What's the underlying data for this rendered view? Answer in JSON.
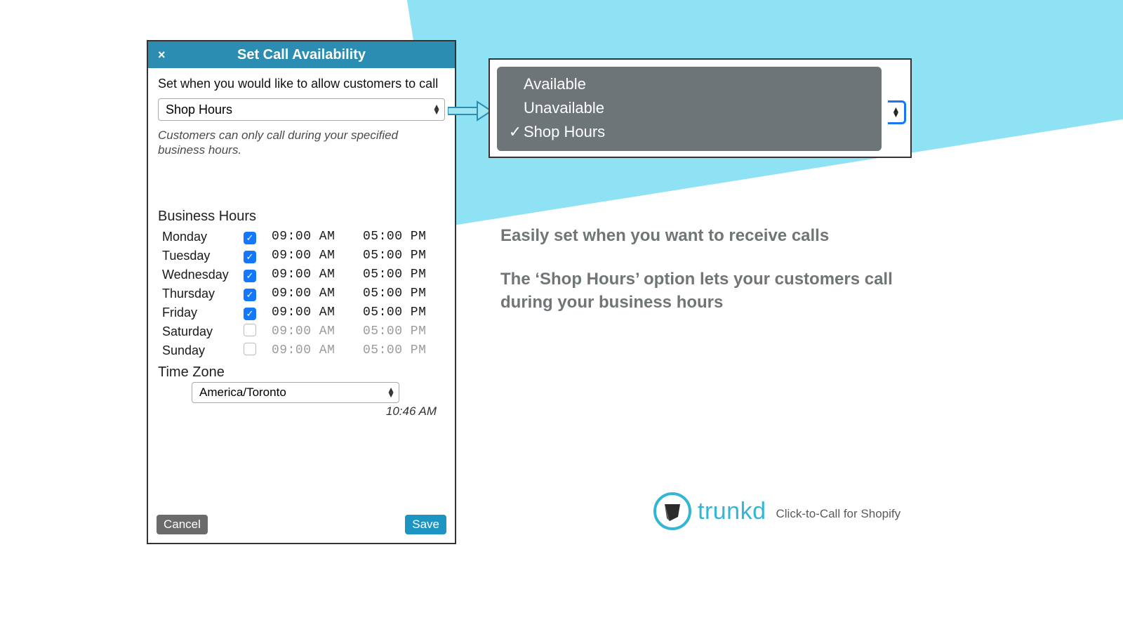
{
  "dialog": {
    "title": "Set Call Availability",
    "prompt": "Set when you would like to allow customers to call",
    "mode_select": {
      "value": "Shop Hours"
    },
    "help_text": "Customers can only call during your specified business hours.",
    "business_hours_heading": "Business Hours",
    "days": [
      {
        "name": "Monday",
        "enabled": true,
        "open": "09:00 AM",
        "close": "05:00 PM"
      },
      {
        "name": "Tuesday",
        "enabled": true,
        "open": "09:00 AM",
        "close": "05:00 PM"
      },
      {
        "name": "Wednesday",
        "enabled": true,
        "open": "09:00 AM",
        "close": "05:00 PM"
      },
      {
        "name": "Thursday",
        "enabled": true,
        "open": "09:00 AM",
        "close": "05:00 PM"
      },
      {
        "name": "Friday",
        "enabled": true,
        "open": "09:00 AM",
        "close": "05:00 PM"
      },
      {
        "name": "Saturday",
        "enabled": false,
        "open": "09:00 AM",
        "close": "05:00 PM"
      },
      {
        "name": "Sunday",
        "enabled": false,
        "open": "09:00 AM",
        "close": "05:00 PM"
      }
    ],
    "timezone_heading": "Time Zone",
    "timezone_value": "America/Toronto",
    "timezone_local_time": "10:46 AM",
    "cancel_label": "Cancel",
    "save_label": "Save"
  },
  "options_menu": {
    "items": [
      {
        "label": "Available",
        "selected": false
      },
      {
        "label": "Unavailable",
        "selected": false
      },
      {
        "label": "Shop Hours",
        "selected": true
      }
    ]
  },
  "marketing": {
    "line1": "Easily set when you want to receive calls",
    "line2": "The ‘Shop Hours’ option lets your customers call during your business hours"
  },
  "brand": {
    "name": "trunkd",
    "tagline": "Click-to-Call for Shopify"
  }
}
